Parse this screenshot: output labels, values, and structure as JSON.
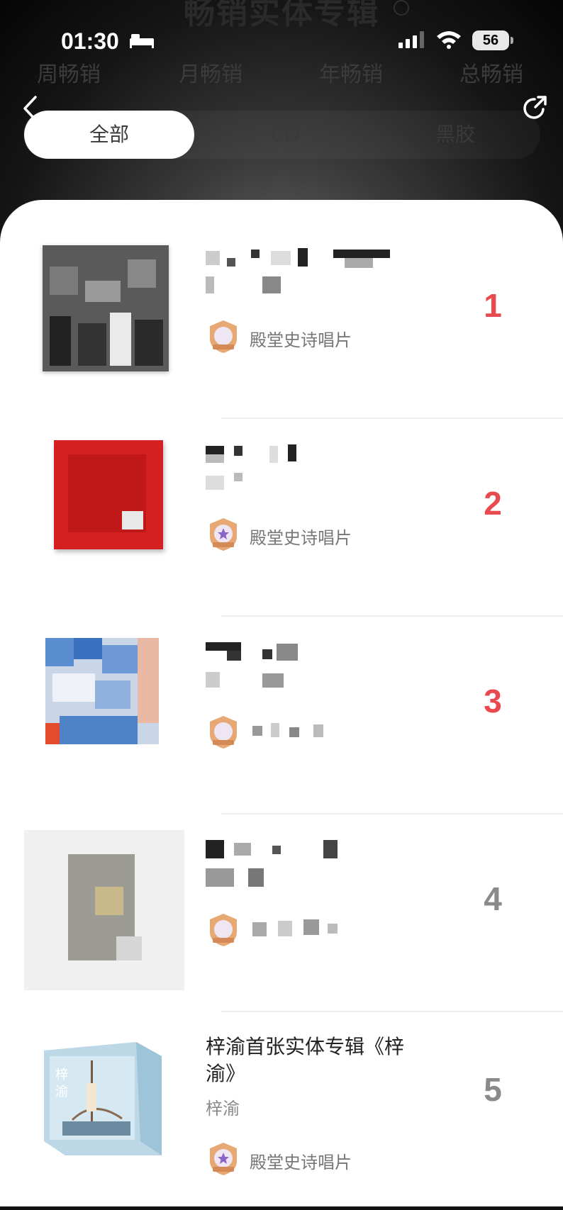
{
  "page": {
    "title": "畅销实体专辑"
  },
  "status_bar": {
    "time": "01:30",
    "battery": "56"
  },
  "period_tabs": [
    "周畅销",
    "月畅销",
    "年畅销",
    "总畅销"
  ],
  "format_tabs": {
    "items": [
      "全部",
      "CD",
      "黑胶"
    ],
    "active": "全部"
  },
  "colors": {
    "rank_top": "#e84a4f",
    "rank_other": "#8a8a8a"
  },
  "albums": [
    {
      "rank": "1",
      "title": "",
      "artist": "",
      "badge": "殿堂史诗唱片"
    },
    {
      "rank": "2",
      "title": "",
      "artist": "",
      "badge": "殿堂史诗唱片"
    },
    {
      "rank": "3",
      "title": "",
      "artist": "",
      "badge": ""
    },
    {
      "rank": "4",
      "title": "",
      "artist": "",
      "badge": ""
    },
    {
      "rank": "5",
      "title": "梓渝首张实体专辑《梓渝》",
      "artist": "梓渝",
      "badge": "殿堂史诗唱片"
    }
  ]
}
